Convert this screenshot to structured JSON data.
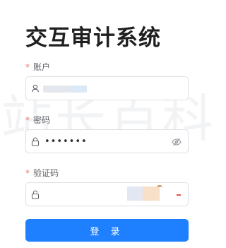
{
  "page": {
    "title": "交互审计系统",
    "watermark": "站长百科"
  },
  "form": {
    "account": {
      "required_mark": "*",
      "label": "账户",
      "icon": "user-icon"
    },
    "password": {
      "required_mark": "*",
      "label": "密码",
      "value": "•••••••",
      "icon": "lock-icon",
      "toggle_icon": "eye-hidden-icon"
    },
    "captcha": {
      "required_mark": "*",
      "label": "验证码",
      "icon": "lock-icon"
    },
    "submit_label": "登 录"
  },
  "colors": {
    "primary": "#1e80ff",
    "required": "#f56c6c"
  }
}
